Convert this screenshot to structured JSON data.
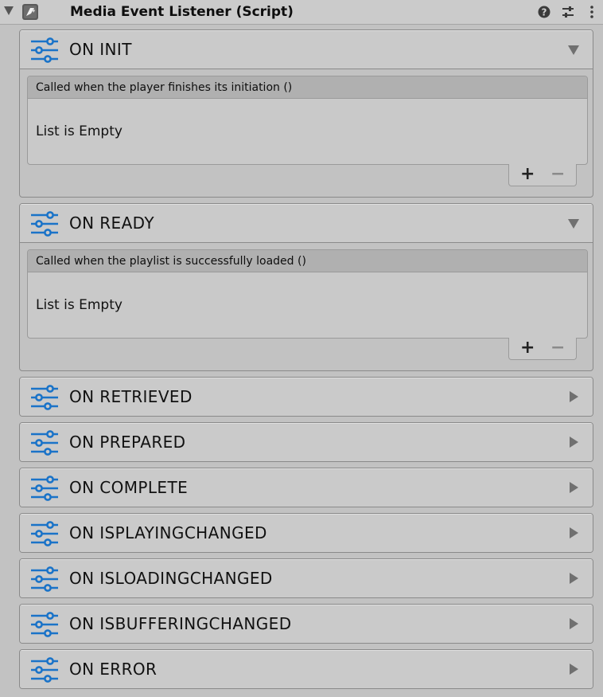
{
  "component": {
    "title": "Media Event Listener (Script)",
    "icons": [
      "script-icon",
      "help-icon",
      "presets-icon",
      "more-icon"
    ]
  },
  "colors": {
    "accent": "#1a73c8",
    "panel_bg": "#c2c2c2",
    "header_bg": "#cacaca"
  },
  "sections": [
    {
      "label": "ON INIT",
      "expanded": true,
      "event_title": "Called when the player finishes its initiation ()",
      "empty_text": "List is Empty",
      "plus": "+",
      "minus": "−"
    },
    {
      "label": "ON READY",
      "expanded": true,
      "event_title": "Called when the playlist is successfully loaded ()",
      "empty_text": "List is Empty",
      "plus": "+",
      "minus": "−"
    },
    {
      "label": "ON RETRIEVED",
      "expanded": false
    },
    {
      "label": "ON PREPARED",
      "expanded": false
    },
    {
      "label": "ON COMPLETE",
      "expanded": false
    },
    {
      "label": "ON ISPLAYINGCHANGED",
      "expanded": false
    },
    {
      "label": "ON ISLOADINGCHANGED",
      "expanded": false
    },
    {
      "label": "ON ISBUFFERINGCHANGED",
      "expanded": false
    },
    {
      "label": "ON ERROR",
      "expanded": false
    }
  ]
}
